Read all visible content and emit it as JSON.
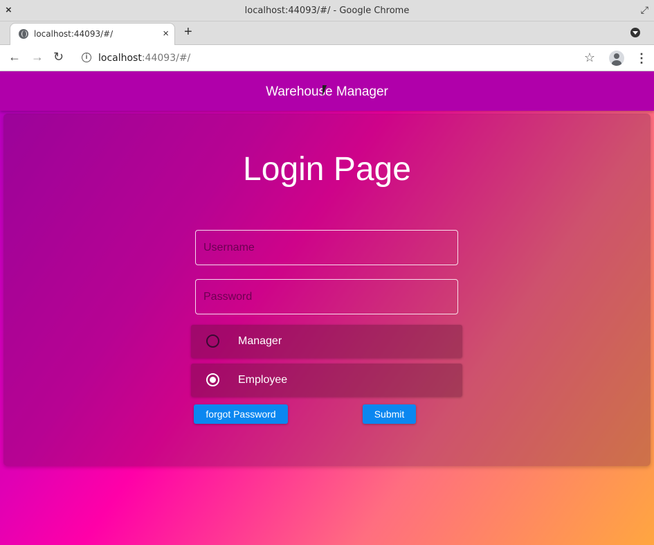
{
  "window": {
    "title": "localhost:44093/#/ - Google Chrome",
    "close_icon": "×",
    "maximize_icon": "⤢"
  },
  "tabs": [
    {
      "label": "localhost:44093/#/",
      "close": "×"
    }
  ],
  "new_tab_icon": "+",
  "address_bar": {
    "url_host": "localhost",
    "url_path": ":44093/#/",
    "back_icon": "←",
    "forward_icon": "→",
    "reload_icon": "↻",
    "star_icon": "☆",
    "menu_icon": "⋮"
  },
  "app": {
    "title": "Warehouse Manager",
    "colors": {
      "header": "#b000aa",
      "button": "#0b87f0"
    }
  },
  "login": {
    "heading": "Login Page",
    "username_placeholder": "Username",
    "password_placeholder": "Password",
    "roles": [
      {
        "label": "Manager",
        "selected": false
      },
      {
        "label": "Employee",
        "selected": true
      }
    ],
    "forgot_label": "forgot Password",
    "submit_label": "Submit"
  }
}
